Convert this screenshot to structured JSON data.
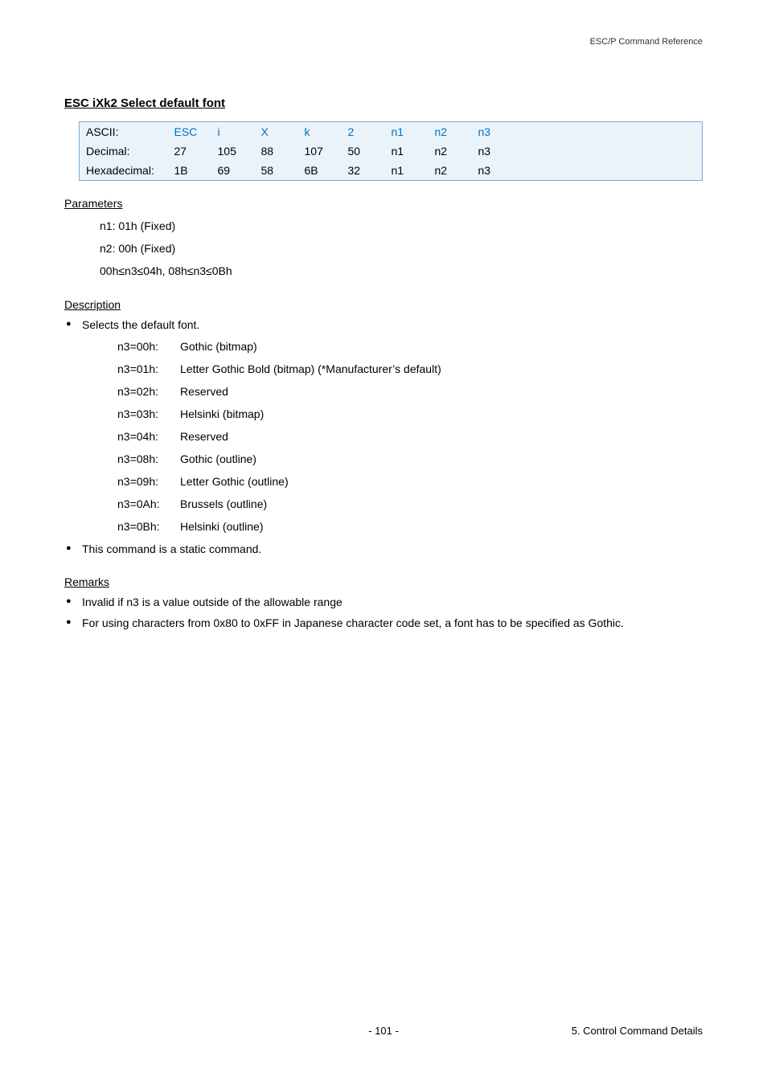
{
  "header": {
    "doc_ref": "ESC/P Command Reference"
  },
  "title": "ESC iXk2   Select default font",
  "code_table": {
    "rows": [
      {
        "label": "ASCII:",
        "cells": [
          "ESC",
          "i",
          "X",
          "k",
          "2",
          "n1",
          "n2",
          "n3"
        ],
        "ascii": true
      },
      {
        "label": "Decimal:",
        "cells": [
          "27",
          "105",
          "88",
          "107",
          "50",
          "n1",
          "n2",
          "n3"
        ],
        "ascii": false
      },
      {
        "label": "Hexadecimal:",
        "cells": [
          "1B",
          "69",
          "58",
          "6B",
          "32",
          "n1",
          "n2",
          "n3"
        ],
        "ascii": false
      }
    ]
  },
  "parameters": {
    "heading": "Parameters",
    "lines": [
      "n1: 01h (Fixed)",
      "n2: 00h (Fixed)",
      "00h≤n3≤04h, 08h≤n3≤0Bh"
    ]
  },
  "description": {
    "heading": "Description",
    "bullets": [
      "Selects the default font.",
      "This command is a static command."
    ],
    "n3_rows": [
      {
        "k": "n3=00h:",
        "v": "Gothic (bitmap)"
      },
      {
        "k": "n3=01h:",
        "v": "Letter Gothic Bold (bitmap) (*Manufacturer’s default)"
      },
      {
        "k": "n3=02h:",
        "v": "Reserved"
      },
      {
        "k": "n3=03h:",
        "v": "Helsinki (bitmap)"
      },
      {
        "k": "n3=04h:",
        "v": "Reserved"
      },
      {
        "k": "n3=08h:",
        "v": "Gothic (outline)"
      },
      {
        "k": "n3=09h:",
        "v": "Letter Gothic (outline)"
      },
      {
        "k": "n3=0Ah:",
        "v": "Brussels (outline)"
      },
      {
        "k": "n3=0Bh:",
        "v": "Helsinki (outline)"
      }
    ]
  },
  "remarks": {
    "heading": "Remarks",
    "bullets": [
      "Invalid if n3 is a value outside of the allowable range",
      "For using characters from 0x80 to 0xFF in Japanese character code set, a font has to be specified as Gothic."
    ]
  },
  "footer": {
    "page_num": "- 101 -",
    "section": "5. Control Command Details"
  }
}
